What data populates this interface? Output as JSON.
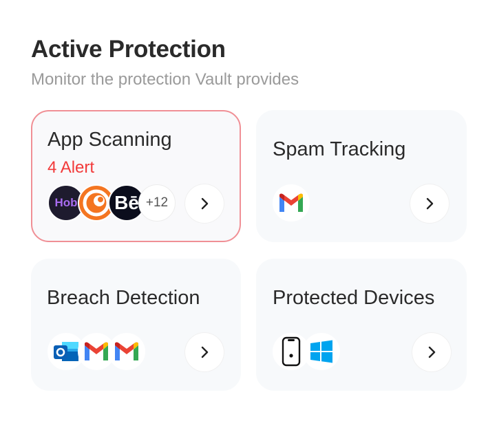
{
  "header": {
    "title": "Active Protection",
    "subtitle": "Monitor the protection Vault provides"
  },
  "cards": [
    {
      "title": "App Scanning",
      "alert": "4 Alert",
      "icons": [
        "hobbyist-app-icon",
        "crunchyroll-icon",
        "behance-icon"
      ],
      "more_count": "+12",
      "hob_text": "Hob",
      "be_text": "Bē"
    },
    {
      "title": "Spam Tracking",
      "icons": [
        "gmail-icon"
      ]
    },
    {
      "title": "Breach Detection",
      "icons": [
        "outlook-icon",
        "gmail-icon",
        "gmail-icon"
      ]
    },
    {
      "title": "Protected Devices",
      "icons": [
        "iphone-icon",
        "windows-icon"
      ]
    }
  ],
  "colors": {
    "alert": "#f23a3a",
    "alert_border": "#f08f95",
    "card_bg": "#f7f9fb"
  }
}
